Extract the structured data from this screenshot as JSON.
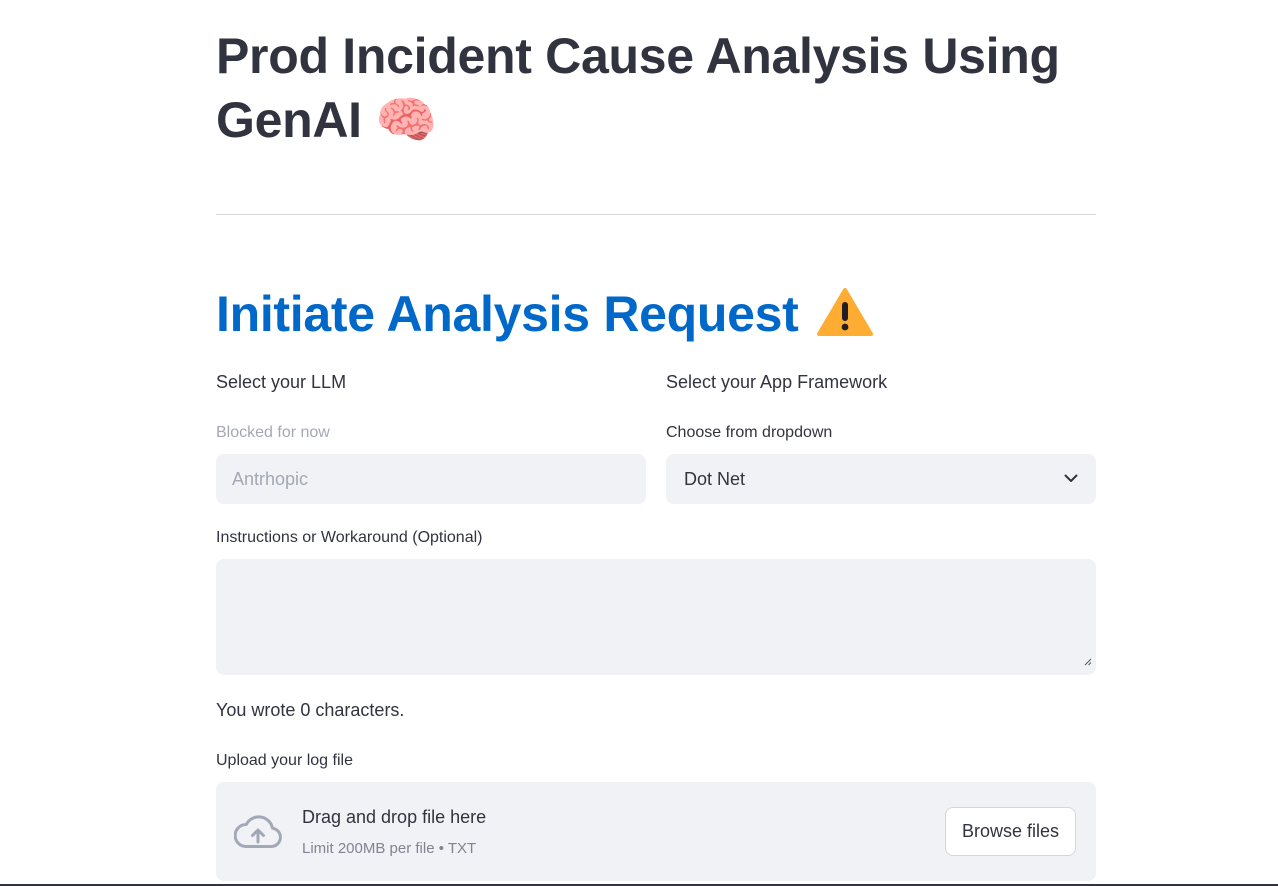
{
  "header": {
    "title": "Prod Incident Cause Analysis Using GenAI",
    "title_emoji": "🧠"
  },
  "section": {
    "title": "Initiate Analysis Request",
    "icon": "warning-icon"
  },
  "llm": {
    "column_label": "Select your LLM",
    "field_label": "Blocked for now",
    "placeholder": "Antrhopic"
  },
  "framework": {
    "column_label": "Select your App Framework",
    "field_label": "Choose from dropdown",
    "selected": "Dot Net"
  },
  "instructions": {
    "label": "Instructions or Workaround (Optional)",
    "value": "",
    "char_count_text": "You wrote 0 characters."
  },
  "upload": {
    "label": "Upload your log file",
    "drop_text": "Drag and drop file here",
    "limit_text": "Limit 200MB per file • TXT",
    "browse_label": "Browse files",
    "icon": "cloud-upload-icon"
  },
  "colors": {
    "accent_blue": "#0068c9",
    "text": "#31333f",
    "input_bg": "#f0f2f6",
    "warning": "#ffac33"
  }
}
